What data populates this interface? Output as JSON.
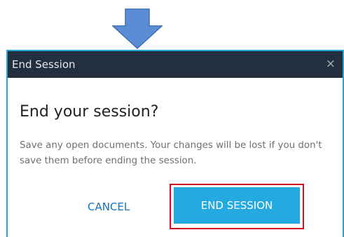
{
  "dialog": {
    "title": "End Session",
    "close_glyph": "×",
    "heading": "End your session?",
    "message": "Save any open documents. Your changes will be lost if you don't save them before ending the session.",
    "cancel_label": "CANCEL",
    "confirm_label": "END SESSION"
  },
  "icons": {
    "pointer_arrow": "down-arrow-icon",
    "close": "close-icon"
  },
  "colors": {
    "titlebar": "#232f3e",
    "accent_border": "#22a8da",
    "primary_button": "#24a9e0",
    "cancel_text": "#1a73b5",
    "highlight_box": "#d01020",
    "arrow_fill": "#5b8dd6"
  }
}
